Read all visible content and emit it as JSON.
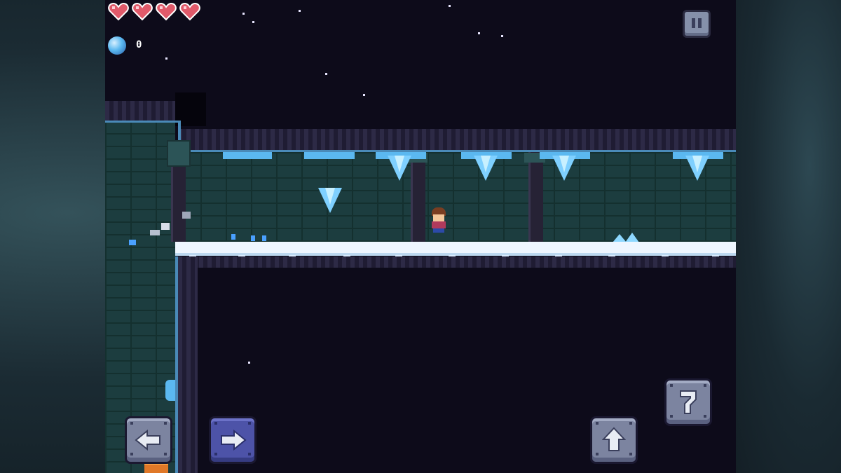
{
  "hud": {
    "hearts": 4,
    "gem_count": "0",
    "pause_icon": "pause-icon",
    "gem_icon": "blue-orb-icon"
  },
  "controls": {
    "move_left": {
      "icon": "arrow-left-icon"
    },
    "move_right": {
      "icon": "arrow-right-icon"
    },
    "jump": {
      "icon": "arrow-up-icon"
    },
    "action": {
      "icon": "hook-icon"
    }
  },
  "colors": {
    "heart": "#e05a6a",
    "ice": "#7fd0ff",
    "snow": "#eef6ff",
    "button_grey": "#7c84a0",
    "button_blue": "#4d53a8",
    "background": "#0d0b1a",
    "wall": "#1c3d3f"
  }
}
